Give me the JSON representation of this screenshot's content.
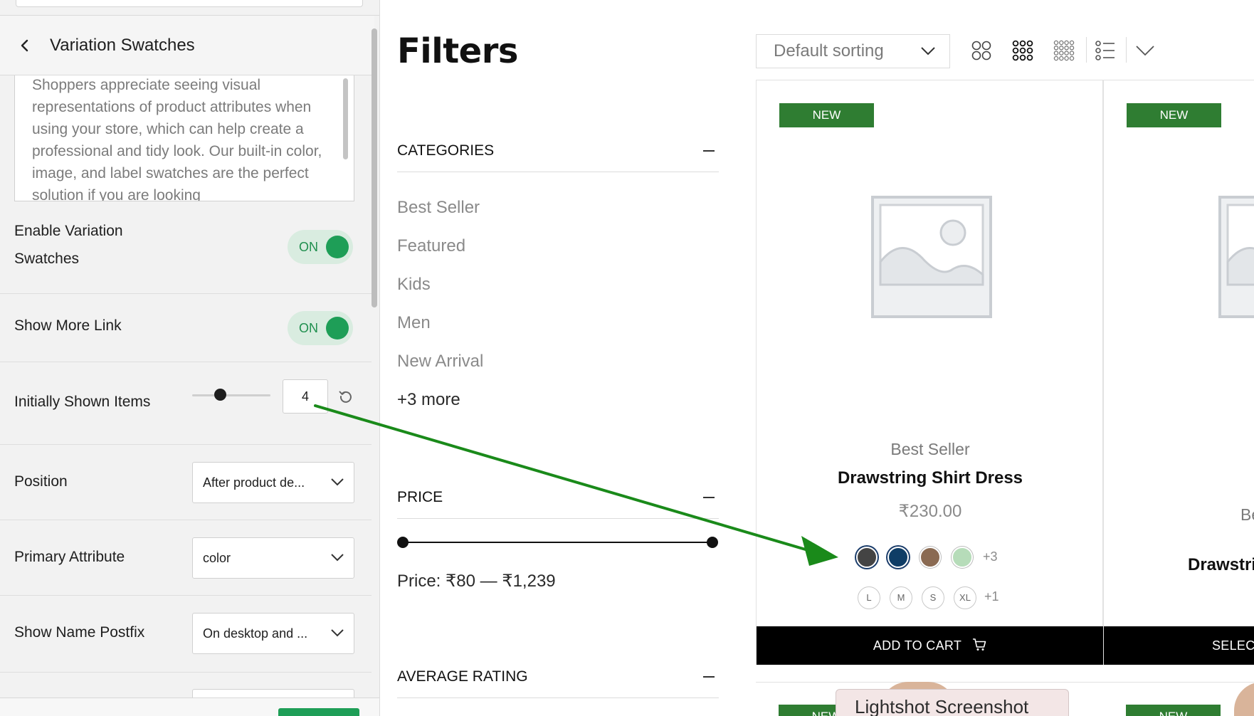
{
  "colors": {
    "accent_green": "#1e9e57",
    "badge_green": "#2f7d32",
    "annotation_arrow": "#1a8a1a"
  },
  "panel": {
    "title": "Variation Swatches",
    "back_icon": "chevron-left-icon",
    "description": "Shoppers appreciate seeing visual representations of product attributes when using your store, which can help create a professional and tidy look. Our built-in color, image, and label swatches are the perfect solution if you are looking",
    "enable_swatches": {
      "label": "Enable Variation Swatches",
      "state": "ON"
    },
    "show_more_link": {
      "label": "Show More Link",
      "state": "ON"
    },
    "initially_shown": {
      "label": "Initially Shown Items",
      "value": "4",
      "slider_fraction": 0.33
    },
    "position": {
      "label": "Position",
      "value": "After product de..."
    },
    "primary_attribute": {
      "label": "Primary Attribute",
      "value": "color"
    },
    "show_name_postfix": {
      "label": "Show Name Postfix",
      "value": "On desktop and ..."
    }
  },
  "preview": {
    "filters_title": "Filters",
    "categories": {
      "heading": "CATEGORIES",
      "items": [
        "Best Seller",
        "Featured",
        "Kids",
        "Men",
        "New Arrival"
      ],
      "more": "+3 more"
    },
    "price": {
      "heading": "PRICE",
      "text": "Price: ₹80 — ₹1,239"
    },
    "rating": {
      "heading": "AVERAGE RATING"
    },
    "sorting": {
      "value": "Default sorting"
    },
    "products": [
      {
        "badge": "NEW",
        "category": "Best Seller",
        "name": "Drawstring Shirt Dress",
        "price": "₹230.00",
        "colors": [
          "#444444",
          "#0f3d66",
          "#8a6a52",
          "#b6dcb9"
        ],
        "colors_more": "+3",
        "sizes": [
          "L",
          "M",
          "S",
          "XL"
        ],
        "sizes_more": "+1",
        "button": "ADD TO CART"
      },
      {
        "badge": "NEW",
        "category": "Be",
        "name": "Drawstri",
        "button": "SELECT"
      }
    ],
    "row2_badge": "NEW",
    "lightshot_tooltip": "Lightshot Screenshot"
  }
}
